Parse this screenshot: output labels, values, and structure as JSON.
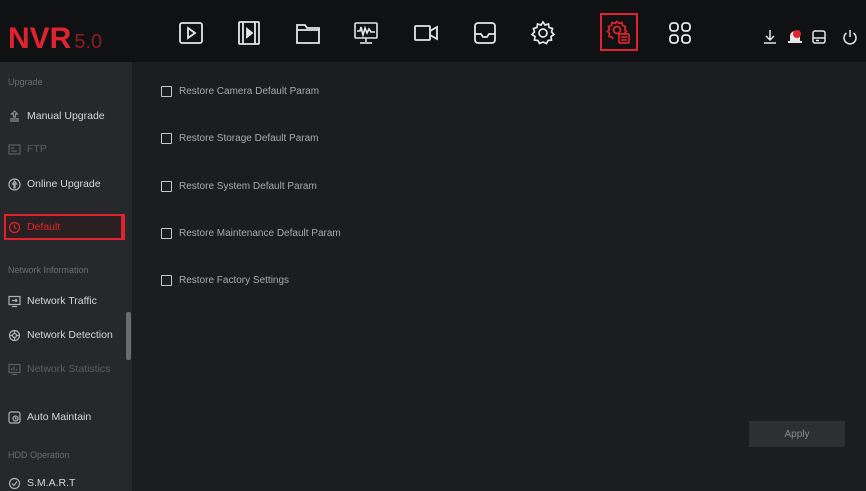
{
  "logo": {
    "brand": "NVR",
    "version": "5.0"
  },
  "topnav": {
    "icons": [
      "playback-icon",
      "video-clip-icon",
      "file-folder-icon",
      "monitor-waveform-icon",
      "camera-icon",
      "storage-tray-icon",
      "settings-gear-icon",
      "system-maintenance-icon",
      "apps-grid-icon"
    ],
    "active": "system-maintenance-icon",
    "right_icons": [
      "download-icon",
      "alarm-icon",
      "disk-icon",
      "power-icon"
    ]
  },
  "sidebar": {
    "sections": [
      {
        "title": "Upgrade"
      },
      {
        "title": "Network Information"
      },
      {
        "title": "HDD Operation"
      }
    ],
    "items": [
      {
        "label": "Manual Upgrade",
        "icon": "upgrade-icon"
      },
      {
        "label": "FTP",
        "icon": "ftp-icon",
        "disabled": true
      },
      {
        "label": "Online Upgrade",
        "icon": "online-upgrade-icon"
      },
      {
        "label": "Default",
        "icon": "default-restore-icon",
        "active": true
      },
      {
        "label": "Network Traffic",
        "icon": "network-traffic-icon"
      },
      {
        "label": "Network Detection",
        "icon": "network-detection-icon"
      },
      {
        "label": "Network Statistics",
        "icon": "network-statistics-icon",
        "disabled": true
      },
      {
        "label": "Auto Maintain",
        "icon": "auto-maintain-icon"
      },
      {
        "label": "S.M.A.R.T",
        "icon": "smart-icon"
      }
    ]
  },
  "main": {
    "options": [
      {
        "label": "Restore Camera Default Param",
        "checked": false
      },
      {
        "label": "Restore Storage Default Param",
        "checked": false
      },
      {
        "label": "Restore System Default Param",
        "checked": false
      },
      {
        "label": "Restore Maintenance Default Param",
        "checked": false
      },
      {
        "label": "Restore Factory Settings",
        "checked": false
      }
    ],
    "apply_label": "Apply"
  },
  "colors": {
    "accent": "#e0232e",
    "background": "#1c1d20",
    "sidebar": "#27282c",
    "topbar": "#101113"
  }
}
